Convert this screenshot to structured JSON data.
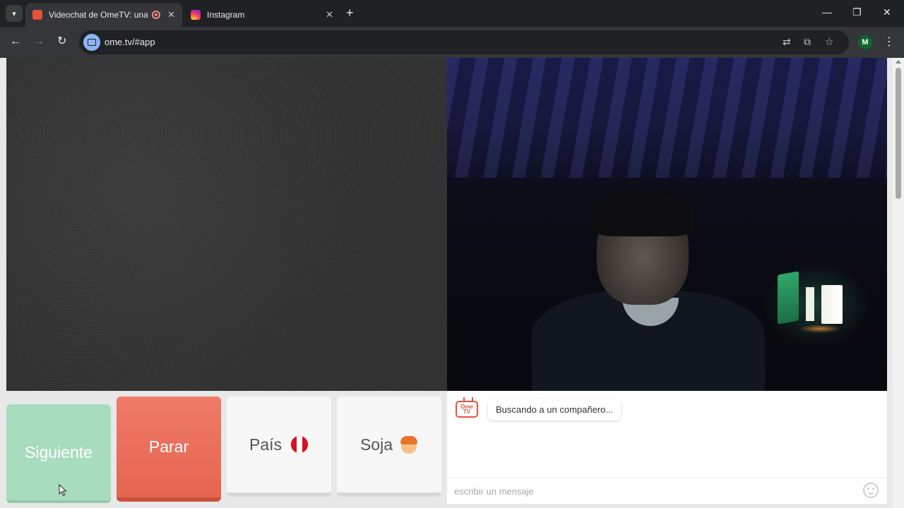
{
  "browser": {
    "tabs": [
      {
        "title": "Videochat de OmeTV: una a",
        "favicon_color": "#e8523c",
        "recording": true,
        "active": true
      },
      {
        "title": "Instagram",
        "favicon_color": "#d6249f",
        "active": false
      }
    ],
    "new_tab": "+",
    "window": {
      "minimize": "—",
      "restore": "❐",
      "close": "✕"
    },
    "url": "ome.tv/#app",
    "profile_initial": "M"
  },
  "controls": {
    "next_label": "Siguiente",
    "stop_label": "Parar",
    "country_label": "País",
    "country_flag": "peru-flag",
    "gender_label": "Soja",
    "gender_icon": "boy-face-icon"
  },
  "chat": {
    "logo_text": "Ome TV",
    "status_message": "Buscando a un compañero...",
    "input_placeholder": "escribir un mensaje"
  },
  "colors": {
    "next": "#a8dcbf",
    "stop": "#e96b55",
    "accent": "#e8523c"
  }
}
